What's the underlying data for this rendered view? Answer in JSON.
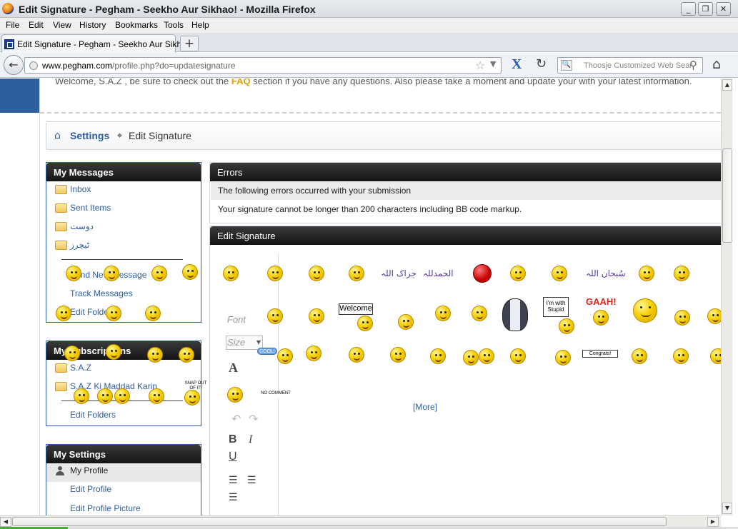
{
  "window": {
    "title": "Edit Signature - Pegham - Seekho Aur Sikhao! - Mozilla Firefox",
    "controls": {
      "minimize": "_",
      "maximize": "❐",
      "close": "✕"
    }
  },
  "menu": [
    "File",
    "Edit",
    "View",
    "History",
    "Bookmarks",
    "Tools",
    "Help"
  ],
  "tab": {
    "label": "Edit Signature - Pegham - Seekho Aur Sikhao!",
    "new_tab": "+"
  },
  "nav": {
    "url_host": "www.pegham.com",
    "url_path": "/profile.php?do=updatesignature",
    "search_placeholder": "Thoosje Customized Web Sear"
  },
  "welcome": {
    "prefix": "Welcome, S.A.Z , be sure to check out the ",
    "faq": "FAQ",
    "suffix": " section if you have any questions. Also please take a moment and update your with your latest information."
  },
  "breadcrumb": {
    "settings": "Settings",
    "current": "Edit Signature"
  },
  "my_messages": {
    "title": "My Messages",
    "folders": [
      "Inbox",
      "Sent Items",
      "دوست",
      "ٹیچرز"
    ],
    "links": [
      "Send New Message",
      "Track Messages",
      "Edit Folders"
    ]
  },
  "my_subscriptions": {
    "title": "My Subscriptions",
    "folders": [
      "S.A.Z",
      "S.A.Z Ki Maddad Karin"
    ],
    "links": [
      "Edit Folders"
    ]
  },
  "my_settings": {
    "title": "My Settings",
    "items": [
      "My Profile",
      "Edit Profile",
      "Edit Profile Picture"
    ]
  },
  "errors": {
    "title": "Errors",
    "summary": "The following errors occurred with your submission",
    "message": "Your signature cannot be longer than 200 characters including BB code markup."
  },
  "edit_signature": {
    "title": "Edit Signature",
    "toolbar": {
      "font": "Font",
      "size": "Size",
      "bold": "B",
      "italic": "I",
      "underline": "U"
    },
    "smiley_text": {
      "jazak": "جزاک اللہ",
      "alhamdulillah": "الحمدللہ",
      "subhanallah": "سُبحان اللہ",
      "welcome_sign": "Welcome",
      "with_stupid": "I'm with Stupid",
      "gaah": "GAAH!",
      "cool": "COOL!",
      "congrats": "Congrats!",
      "no_comment": "NO COMMENT",
      "snap_out": "SNAP OUT OF IT!"
    },
    "more": "[More]"
  }
}
